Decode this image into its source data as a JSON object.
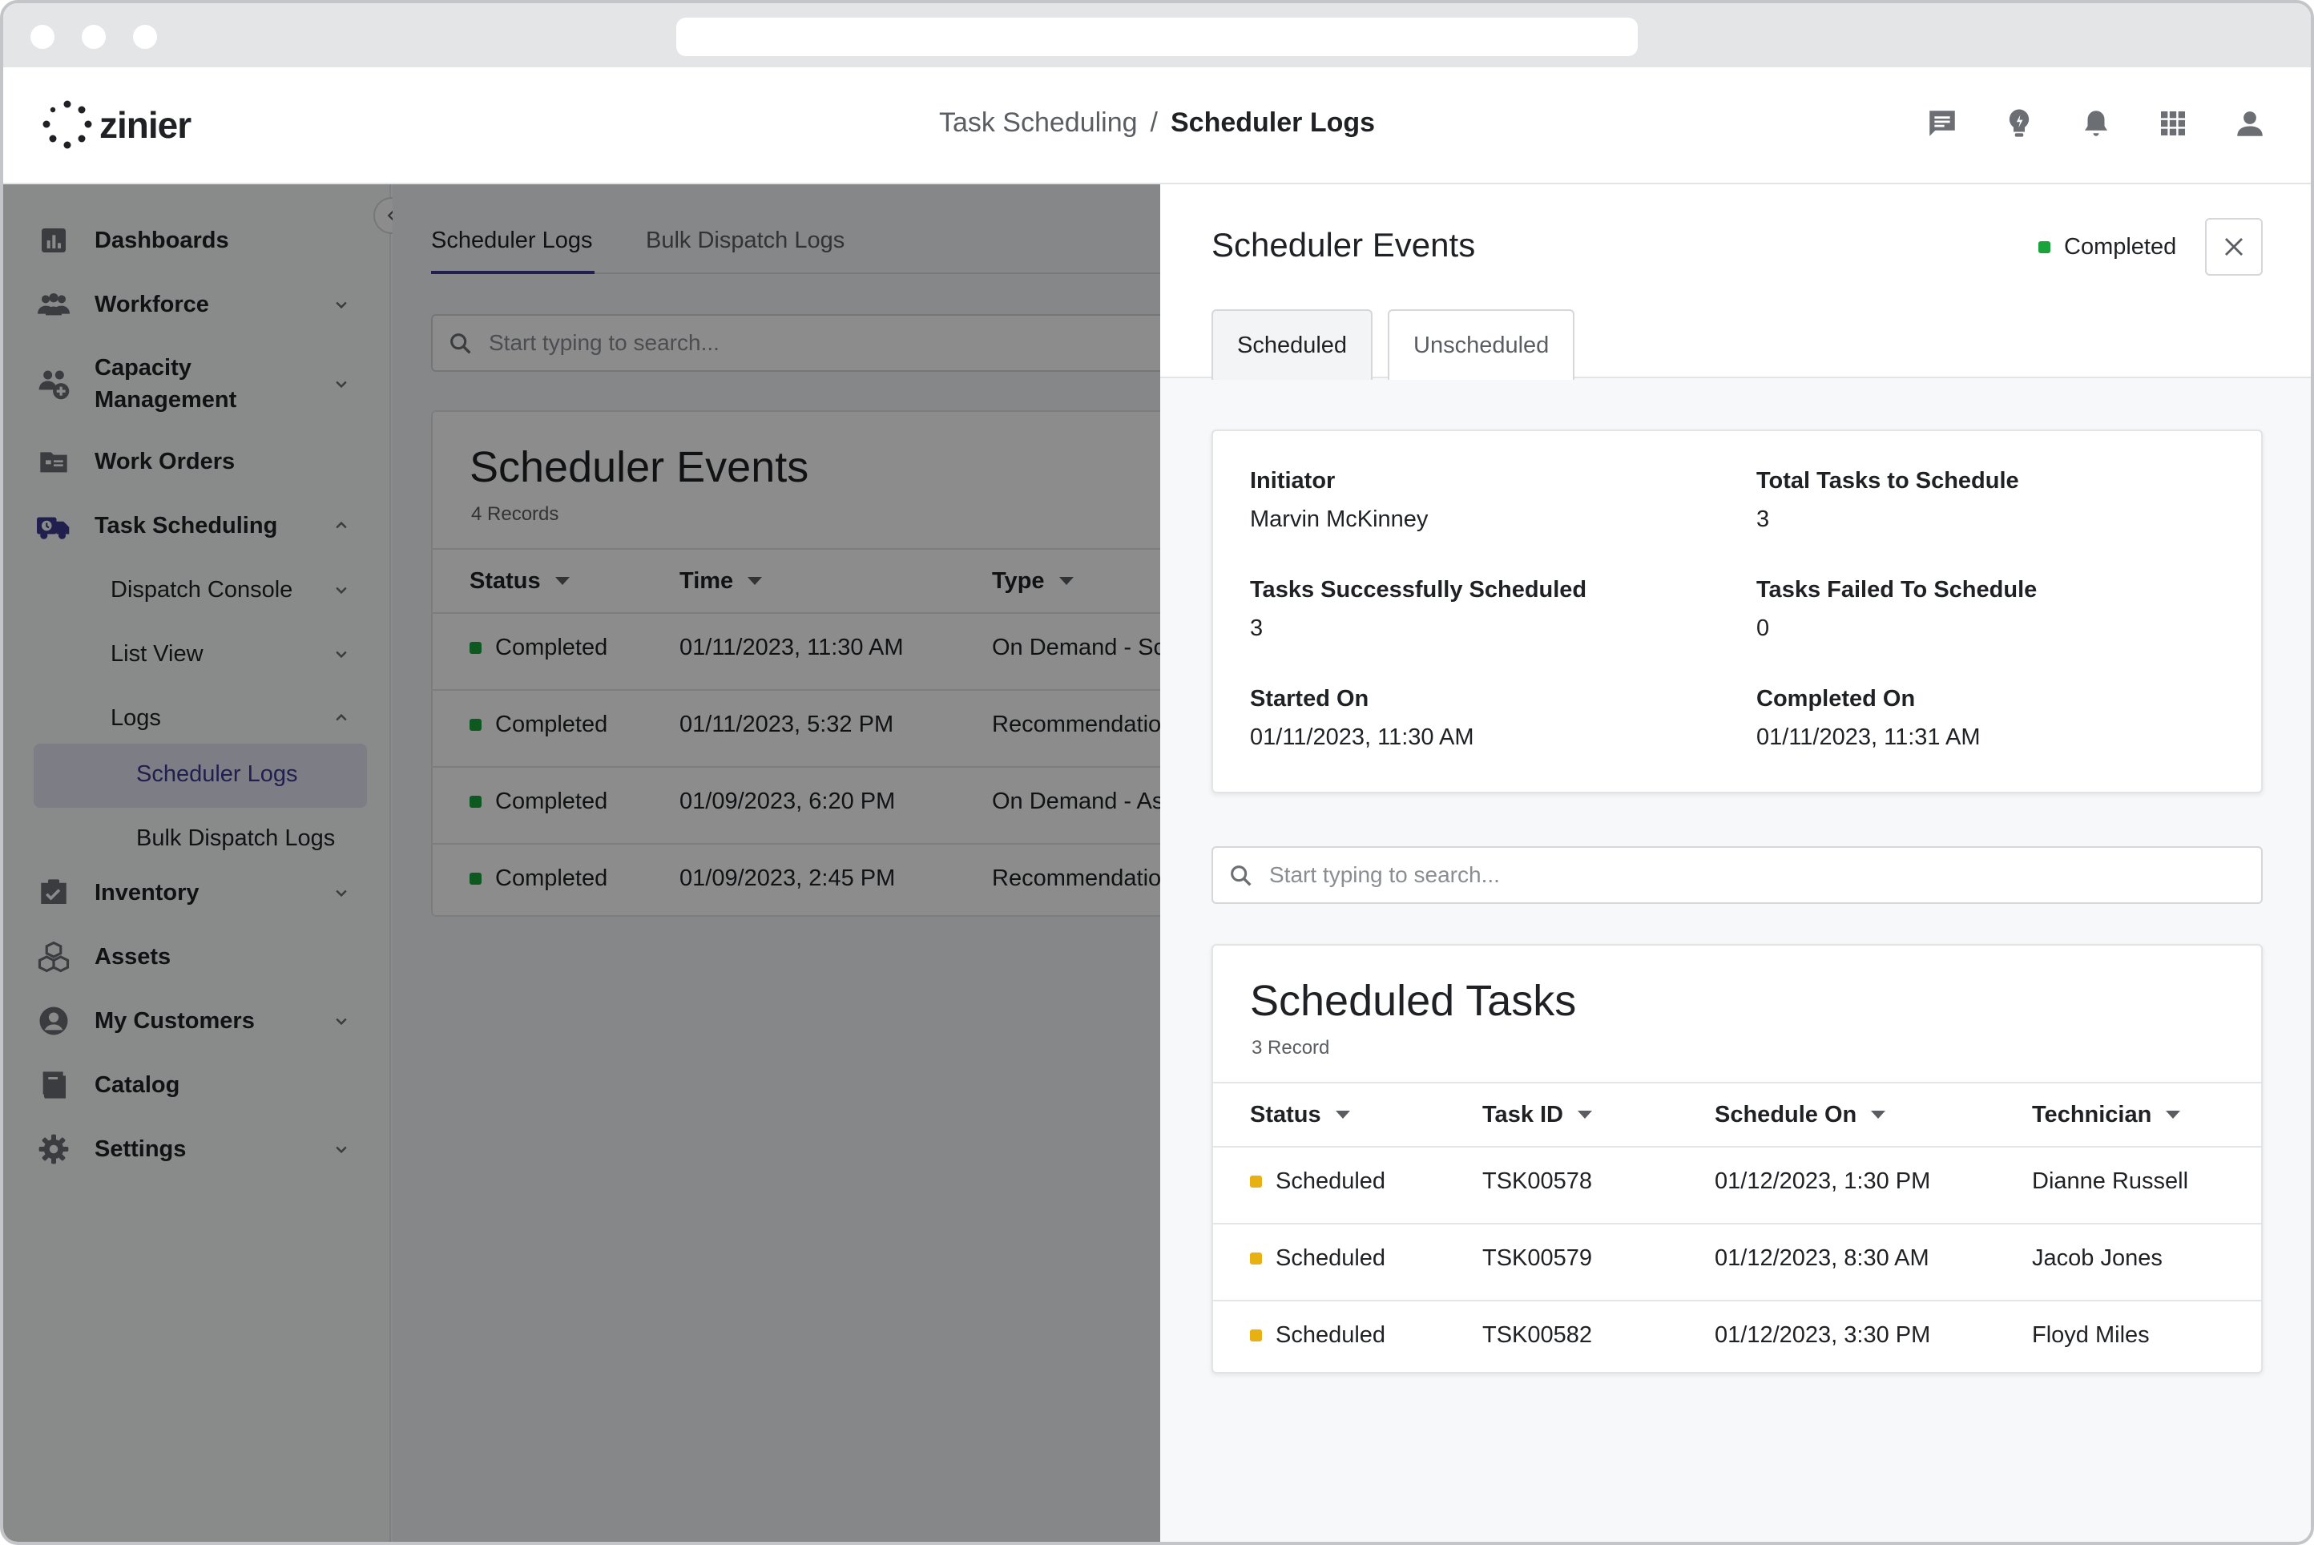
{
  "header": {
    "brand": "zinier",
    "breadcrumb": [
      "Task Scheduling",
      "Scheduler Logs"
    ],
    "breadcrumb_separator": "/",
    "icons": [
      "chat-icon",
      "lightbulb-icon",
      "bell-icon",
      "apps-grid-icon",
      "user-icon"
    ]
  },
  "sidebar": {
    "items": [
      {
        "label": "Dashboards",
        "icon": "dashboard-icon",
        "chevron": false
      },
      {
        "label": "Workforce",
        "icon": "people-icon",
        "chevron": "down"
      },
      {
        "label": "Capacity",
        "label2": "Management",
        "icon": "capacity-icon",
        "chevron": "down"
      },
      {
        "label": "Work Orders",
        "icon": "folder-icon",
        "chevron": false
      },
      {
        "label": "Task Scheduling",
        "icon": "truck-clock-icon",
        "chevron": "up"
      },
      {
        "label": "Inventory",
        "icon": "inventory-icon",
        "chevron": "down"
      },
      {
        "label": "Assets",
        "icon": "cubes-icon",
        "chevron": false
      },
      {
        "label": "My Customers",
        "icon": "account-icon",
        "chevron": "down"
      },
      {
        "label": "Catalog",
        "icon": "book-icon",
        "chevron": false
      },
      {
        "label": "Settings",
        "icon": "gear-icon",
        "chevron": "down"
      }
    ],
    "sub_items": [
      {
        "label": "Dispatch Console",
        "chevron": "down"
      },
      {
        "label": "List View",
        "chevron": "down"
      },
      {
        "label": "Logs",
        "chevron": "up"
      }
    ],
    "sub_sub_items": [
      {
        "label": "Scheduler Logs",
        "active": true
      },
      {
        "label": "Bulk Dispatch Logs",
        "active": false
      }
    ]
  },
  "main": {
    "tabs": [
      "Scheduler Logs",
      "Bulk Dispatch Logs"
    ],
    "active_tab": "Scheduler Logs",
    "search_placeholder": "Start typing to search...",
    "card_title": "Scheduler Events",
    "card_subtitle": "4 Records",
    "columns": [
      "Status",
      "Time",
      "Type"
    ],
    "rows": [
      {
        "status": "Completed",
        "time": "01/11/2023, 11:30 AM",
        "type": "On Demand - Sc"
      },
      {
        "status": "Completed",
        "time": "01/11/2023, 5:32 PM",
        "type": "Recommendatio"
      },
      {
        "status": "Completed",
        "time": "01/09/2023, 6:20 PM",
        "type": "On Demand - As"
      },
      {
        "status": "Completed",
        "time": "01/09/2023, 2:45 PM",
        "type": "Recommendatio"
      }
    ]
  },
  "panel": {
    "title": "Scheduler Events",
    "status": "Completed",
    "tabs": [
      "Scheduled",
      "Unscheduled"
    ],
    "active_tab": "Scheduled",
    "info": [
      {
        "label": "Initiator",
        "value": "Marvin McKinney"
      },
      {
        "label": "Total Tasks to Schedule",
        "value": "3"
      },
      {
        "label": "Tasks Successfully Scheduled",
        "value": "3"
      },
      {
        "label": "Tasks Failed To Schedule",
        "value": "0"
      },
      {
        "label": "Started On",
        "value": "01/11/2023, 11:30 AM"
      },
      {
        "label": "Completed On",
        "value": "01/11/2023, 11:31 AM"
      }
    ],
    "search_placeholder": "Start typing to search...",
    "tasks_title": "Scheduled Tasks",
    "tasks_subtitle": "3 Record",
    "columns": [
      "Status",
      "Task ID",
      "Schedule On",
      "Technician"
    ],
    "rows": [
      {
        "status": "Scheduled",
        "task_id": "TSK00578",
        "schedule_on": "01/12/2023, 1:30 PM",
        "technician": "Dianne Russell"
      },
      {
        "status": "Scheduled",
        "task_id": "TSK00579",
        "schedule_on": "01/12/2023, 8:30 AM",
        "technician": "Jacob Jones"
      },
      {
        "status": "Scheduled",
        "task_id": "TSK00582",
        "schedule_on": "01/12/2023, 3:30 PM",
        "technician": "Floyd Miles"
      }
    ]
  },
  "colors": {
    "completed": "#1aa33a",
    "scheduled": "#e8b012",
    "accent": "#3b3a8f",
    "icon_gray": "#6b6e73"
  }
}
